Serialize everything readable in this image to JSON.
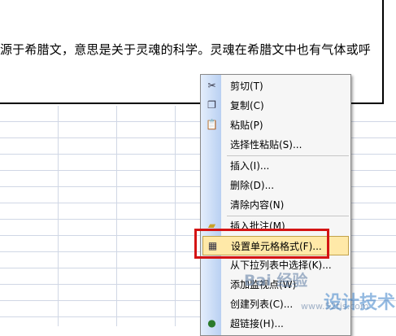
{
  "sheet": {
    "cell_text": "源于希腊文，意思是关于灵魂的科学。灵魂在希腊文中也有气体或呼"
  },
  "context_menu": {
    "items": [
      {
        "label": "剪切(T)",
        "icon": "scissors-icon"
      },
      {
        "label": "复制(C)",
        "icon": "copy-icon"
      },
      {
        "label": "粘贴(P)",
        "icon": "paste-icon"
      },
      {
        "label": "选择性粘贴(S)...",
        "icon": ""
      },
      {
        "label": "插入(I)...",
        "icon": ""
      },
      {
        "label": "删除(D)...",
        "icon": ""
      },
      {
        "label": "清除内容(N)",
        "icon": ""
      },
      {
        "label": "插入批注(M)",
        "icon": "comment-icon"
      },
      {
        "label": "设置单元格格式(F)...",
        "icon": "format-cells-icon",
        "highlighted": true
      },
      {
        "label": "从下拉列表中选择(K)...",
        "icon": ""
      },
      {
        "label": "添加监视点(W)",
        "icon": ""
      },
      {
        "label": "创建列表(C)...",
        "icon": ""
      },
      {
        "label": "超链接(H)...",
        "icon": "hyperlink-icon"
      }
    ]
  },
  "watermark": {
    "text": "Bai 经验",
    "site": "www.52tjs.com",
    "logo": "设计技术网"
  },
  "colors": {
    "highlight": "#ffe9a8",
    "red_box": "#d41414"
  }
}
